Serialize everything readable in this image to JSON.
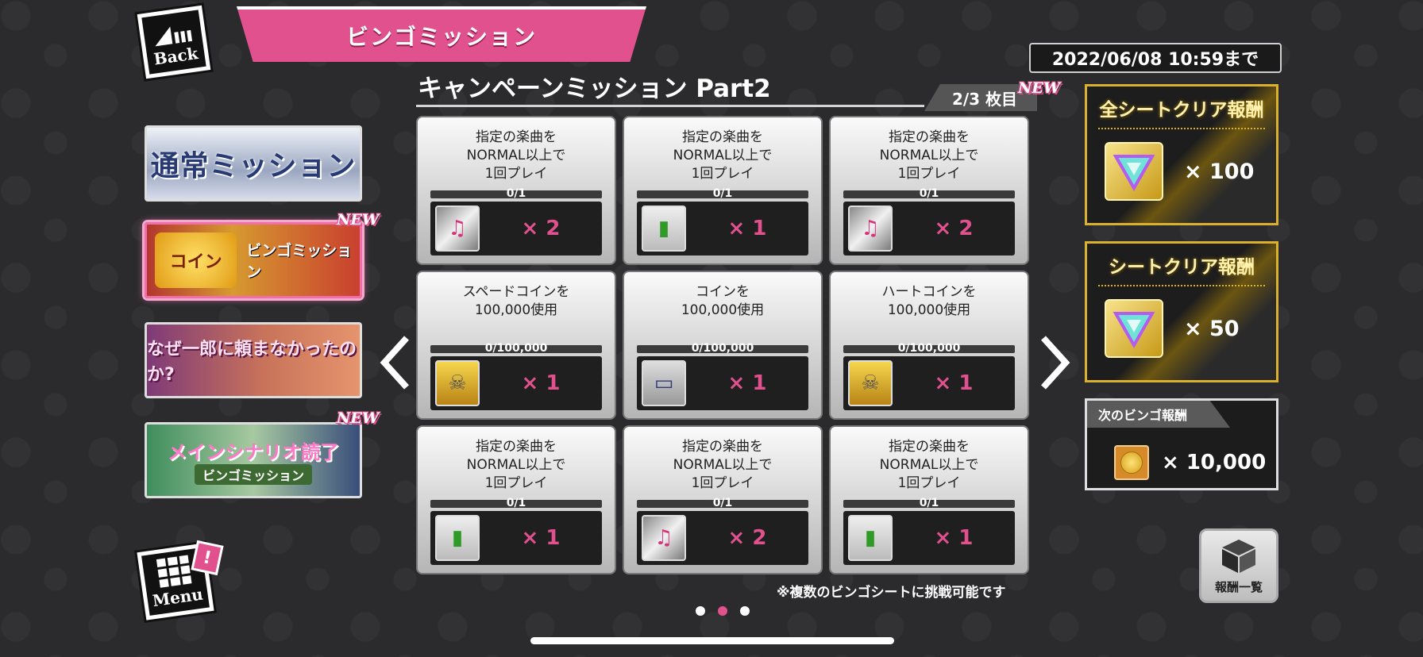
{
  "header": {
    "back_label": "Back",
    "title": "ビンゴミッション",
    "deadline": "2022/06/08 10:59まで"
  },
  "campaign": {
    "title": "キャンペーンミッション Part2",
    "sheet_indicator": "2/3 枚目",
    "new_badge": "NEW"
  },
  "sidebar": {
    "items": [
      {
        "label": "通常ミッション"
      },
      {
        "label": "ビンゴミッション",
        "art_text": "コイン",
        "new_badge": "NEW"
      },
      {
        "label": "なぜ一郎に頼まなかったのか?"
      },
      {
        "label": "メインシナリオ読了",
        "sub_label": "ビンゴミッション",
        "new_badge": "NEW"
      }
    ],
    "menu_label": "Menu",
    "menu_alert": "!"
  },
  "bingo": {
    "cells": [
      {
        "text": "指定の楽曲を\nNORMAL以上で\n1回プレイ",
        "progress": "0/1",
        "progress_fraction": 0,
        "reward_icon": "sheet-music-icon",
        "qty": "× 2"
      },
      {
        "text": "指定の楽曲を\nNORMAL以上で\n1回プレイ",
        "progress": "0/1",
        "progress_fraction": 0,
        "reward_icon": "energy-drink-icon",
        "qty": "× 1"
      },
      {
        "text": "指定の楽曲を\nNORMAL以上で\n1回プレイ",
        "progress": "0/1",
        "progress_fraction": 0,
        "reward_icon": "sheet-music-icon",
        "qty": "× 2"
      },
      {
        "text": "スペードコインを\n100,000使用",
        "progress": "0/100,000",
        "progress_fraction": 0,
        "reward_icon": "skull-medal-icon",
        "qty": "× 1"
      },
      {
        "text": "コインを\n100,000使用",
        "progress": "0/100,000",
        "progress_fraction": 0,
        "reward_icon": "ticket-icon",
        "qty": "× 1"
      },
      {
        "text": "ハートコインを\n100,000使用",
        "progress": "0/100,000",
        "progress_fraction": 0,
        "reward_icon": "skull-medal-icon",
        "qty": "× 1"
      },
      {
        "text": "指定の楽曲を\nNORMAL以上で\n1回プレイ",
        "progress": "0/1",
        "progress_fraction": 0,
        "reward_icon": "energy-drink-icon",
        "qty": "× 1"
      },
      {
        "text": "指定の楽曲を\nNORMAL以上で\n1回プレイ",
        "progress": "0/1",
        "progress_fraction": 0,
        "reward_icon": "sheet-music-icon",
        "qty": "× 2"
      },
      {
        "text": "指定の楽曲を\nNORMAL以上で\n1回プレイ",
        "progress": "0/1",
        "progress_fraction": 0,
        "reward_icon": "energy-drink-icon",
        "qty": "× 1"
      }
    ],
    "note": "※複数のビンゴシートに挑戦可能です",
    "page_count": 3,
    "current_page": 2
  },
  "rewards": {
    "all_clear": {
      "title": "全シートクリア報酬",
      "qty": "× 100",
      "icon": "rainbow-triangle-icon"
    },
    "sheet_clear": {
      "title": "シートクリア報酬",
      "qty": "× 50",
      "icon": "rainbow-triangle-icon"
    },
    "next_bingo": {
      "title": "次のビンゴ報酬",
      "qty": "× 10,000",
      "icon": "coin-icon"
    },
    "list_button": "報酬一覧"
  },
  "colors": {
    "accent_pink": "#e0518e",
    "gold": "#d9b12c",
    "background": "#2b2b2d"
  }
}
